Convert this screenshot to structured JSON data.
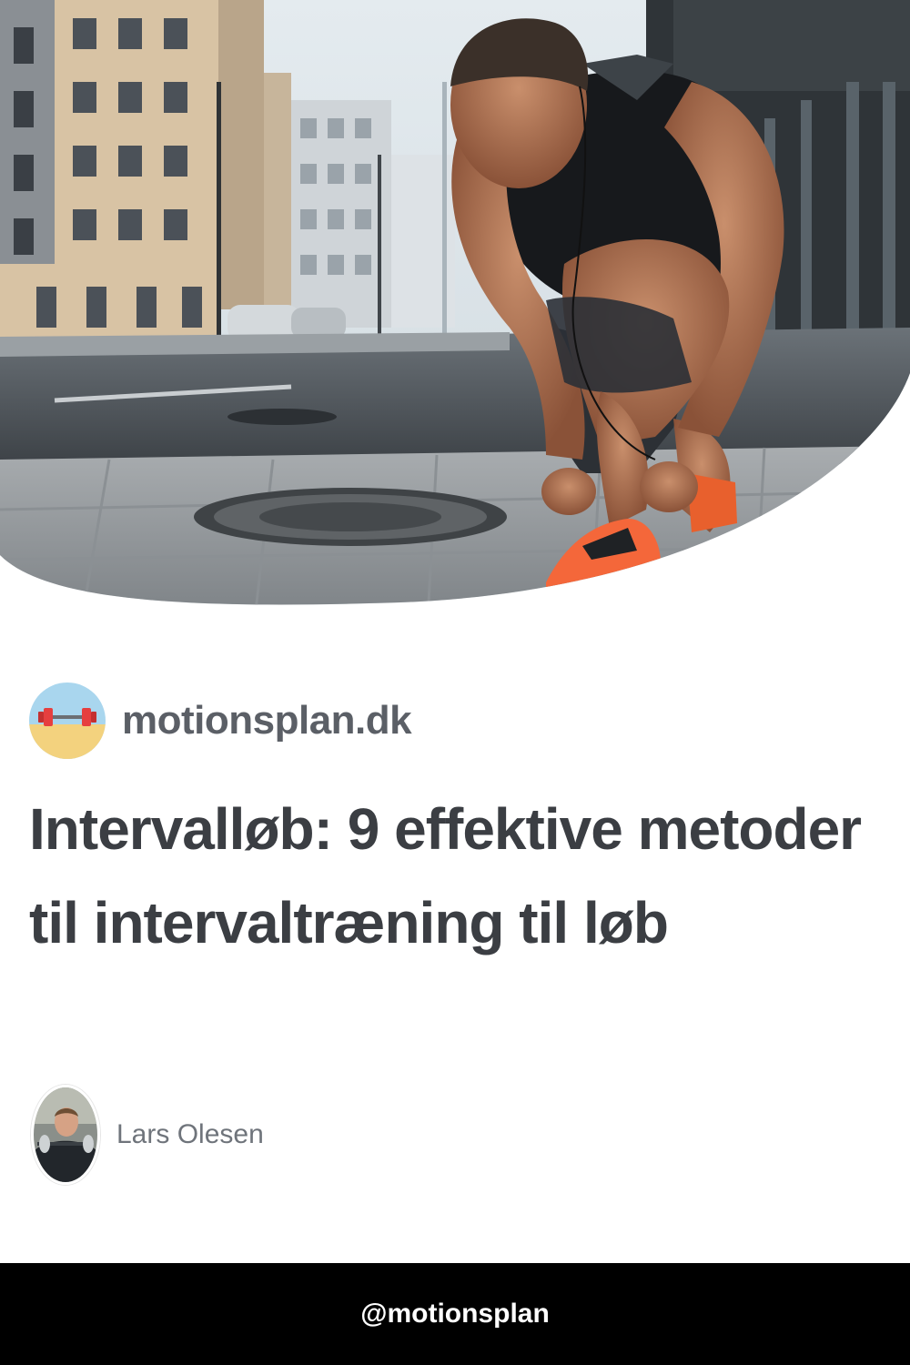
{
  "hero": {
    "image": "runner-tying-orange-shoe-on-city-sidewalk"
  },
  "site": {
    "logo_icon": "barbell-beach-icon",
    "name": "motionsplan.dk"
  },
  "article": {
    "title": "Intervalløb: 9 effektive metoder til intervaltræning til løb"
  },
  "author": {
    "avatar_icon": "author-photo",
    "name": "Lars Olesen"
  },
  "footer": {
    "handle": "@motionsplan"
  },
  "colors": {
    "footer_bg": "#000000",
    "title": "#3b3e43",
    "site_name": "#5b5f66",
    "author_name": "#6f747b",
    "shoe": "#f4673a"
  }
}
